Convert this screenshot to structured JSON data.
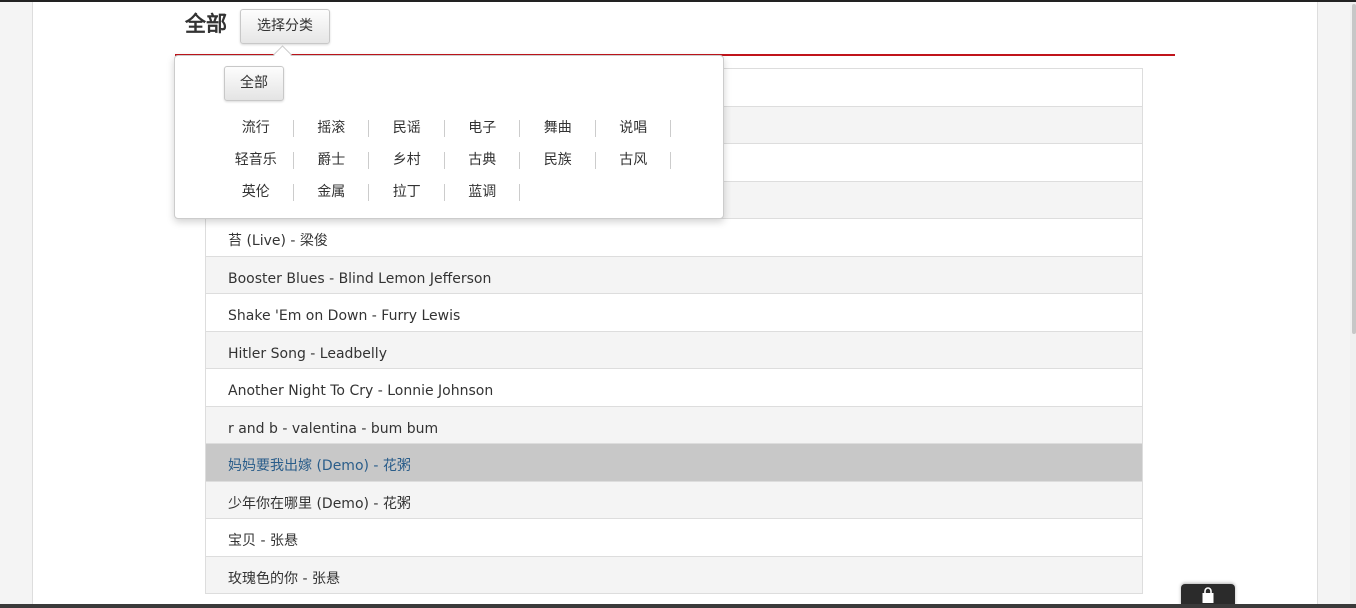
{
  "header": {
    "title": "全部",
    "select_category": "选择分类"
  },
  "popover": {
    "all_label": "全部",
    "genres": [
      "流行",
      "摇滚",
      "民谣",
      "电子",
      "舞曲",
      "说唱",
      "轻音乐",
      "爵士",
      "乡村",
      "古典",
      "民族",
      "古风",
      "英伦",
      "金属",
      "拉丁",
      "蓝调"
    ]
  },
  "songs": [
    "",
    "",
    "",
    "",
    "苔 (Live) - 梁俊",
    "Booster Blues - Blind Lemon Jefferson",
    "Shake 'Em on Down - Furry Lewis",
    "Hitler Song - Leadbelly",
    "Another Night To Cry - Lonnie Johnson",
    "r and b - valentina - bum bum",
    "妈妈要我出嫁 (Demo) - 花粥",
    "少年你在哪里 (Demo) - 花粥",
    "宝贝 - 张悬",
    "玫瑰色的你 - 张悬"
  ],
  "icons": {
    "bag": "shopping-bag-icon"
  },
  "colors": {
    "accent_line": "#c0141b",
    "highlight_row": "#c8c8c8",
    "highlight_text": "#2a5d8a"
  }
}
